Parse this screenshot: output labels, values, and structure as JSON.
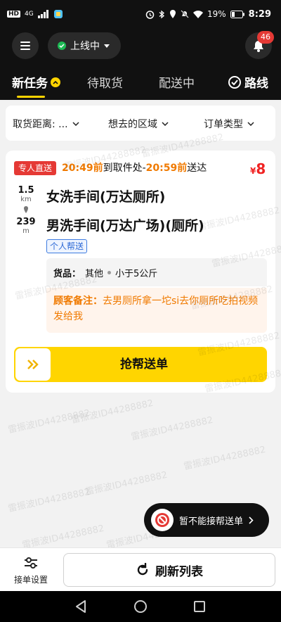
{
  "status_bar": {
    "network_chip": "HD",
    "signal_label": "4G",
    "battery": "19%",
    "time": "8:29"
  },
  "header": {
    "online_status": "上线中",
    "notification_count": "46"
  },
  "tabs": [
    {
      "label": "新任务",
      "active": true
    },
    {
      "label": "待取货",
      "active": false
    },
    {
      "label": "配送中",
      "active": false
    },
    {
      "label": "路线",
      "active": false
    }
  ],
  "filters": {
    "distance": "取货距离: ...",
    "area": "想去的区域",
    "order_type": "订单类型"
  },
  "order": {
    "tag": "专人直送",
    "pickup_time": "20:49前",
    "pickup_text": "到取件处-",
    "deliver_time": "20:59前",
    "deliver_text": "送达",
    "currency": "¥",
    "price": "8",
    "distance_to_pickup": "1.5",
    "distance_to_pickup_unit": "km",
    "distance_to_drop": "239",
    "distance_to_drop_unit": "m",
    "from": "女洗手间(万达厕所)",
    "to": "男洗手间(万达广场)(厕所)",
    "service_tag": "个人帮送",
    "goods_label": "货品：",
    "goods_type": "其他",
    "goods_weight": "小于5公斤",
    "note_label": "顾客备注：",
    "note": "去男厕所拿一坨si去你厕所吃拍视频发给我",
    "grab_label": "抢帮送单"
  },
  "watermark": "雷振波ID44288882",
  "reject_label": "暂不能接帮送单",
  "bottom": {
    "settings_label": "接单设置",
    "refresh_label": "刷新列表"
  }
}
